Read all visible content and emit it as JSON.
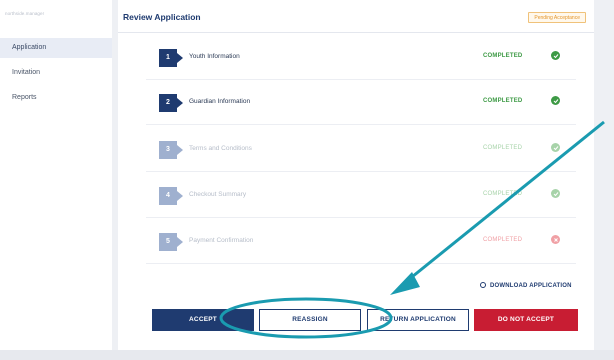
{
  "sidebar": {
    "brand": "northside.manager",
    "items": [
      {
        "label": "Application",
        "active": true
      },
      {
        "label": "Invitation",
        "active": false
      },
      {
        "label": "Reports",
        "active": false
      }
    ]
  },
  "header": {
    "title": "Review Application",
    "status": "Pending Acceptance"
  },
  "steps": [
    {
      "number": "1",
      "label": "Youth Information",
      "state": "COMPLETED",
      "style": "done"
    },
    {
      "number": "2",
      "label": "Guardian Information",
      "state": "COMPLETED",
      "style": "done"
    },
    {
      "number": "3",
      "label": "Terms and Conditions",
      "state": "COMPLETED",
      "style": "dim"
    },
    {
      "number": "4",
      "label": "Checkout Summary",
      "state": "COMPLETED",
      "style": "dim"
    },
    {
      "number": "5",
      "label": "Payment Confirmation",
      "state": "COMPLETED",
      "style": "err"
    }
  ],
  "download": {
    "label": "DOWNLOAD APPLICATION"
  },
  "actions": {
    "accept": "ACCEPT",
    "reassign": "REASSIGN",
    "return": "RETURN APPLICATION",
    "decline": "DO NOT ACCEPT"
  },
  "colors": {
    "navy": "#1f3b70",
    "green": "#3d9a45",
    "red": "#c81d33",
    "annotation": "#1a9bb0"
  }
}
